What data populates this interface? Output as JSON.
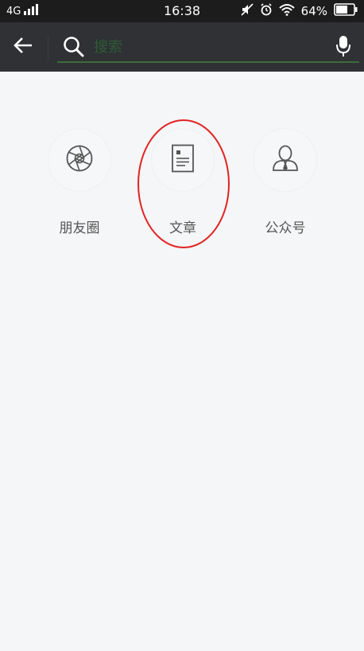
{
  "status_bar": {
    "network": "4G",
    "time": "16:38",
    "battery_percent": "64%",
    "icons": [
      "signal-icon",
      "mute-icon",
      "alarm-icon",
      "wifi-icon",
      "battery-icon"
    ]
  },
  "search": {
    "placeholder": "搜索",
    "value": "",
    "back_icon": "back-arrow-icon",
    "search_icon": "search-icon",
    "mic_icon": "microphone-icon"
  },
  "categories": [
    {
      "label": "朋友圈",
      "icon": "shutter-icon"
    },
    {
      "label": "文章",
      "icon": "article-icon"
    },
    {
      "label": "公众号",
      "icon": "official-account-icon"
    }
  ],
  "colors": {
    "status_bar_bg": "#1c1c1c",
    "search_bar_bg": "#2f3134",
    "search_underline": "#3e6a3f",
    "page_bg": "#f4f6f7",
    "annotation": "#e12222"
  }
}
